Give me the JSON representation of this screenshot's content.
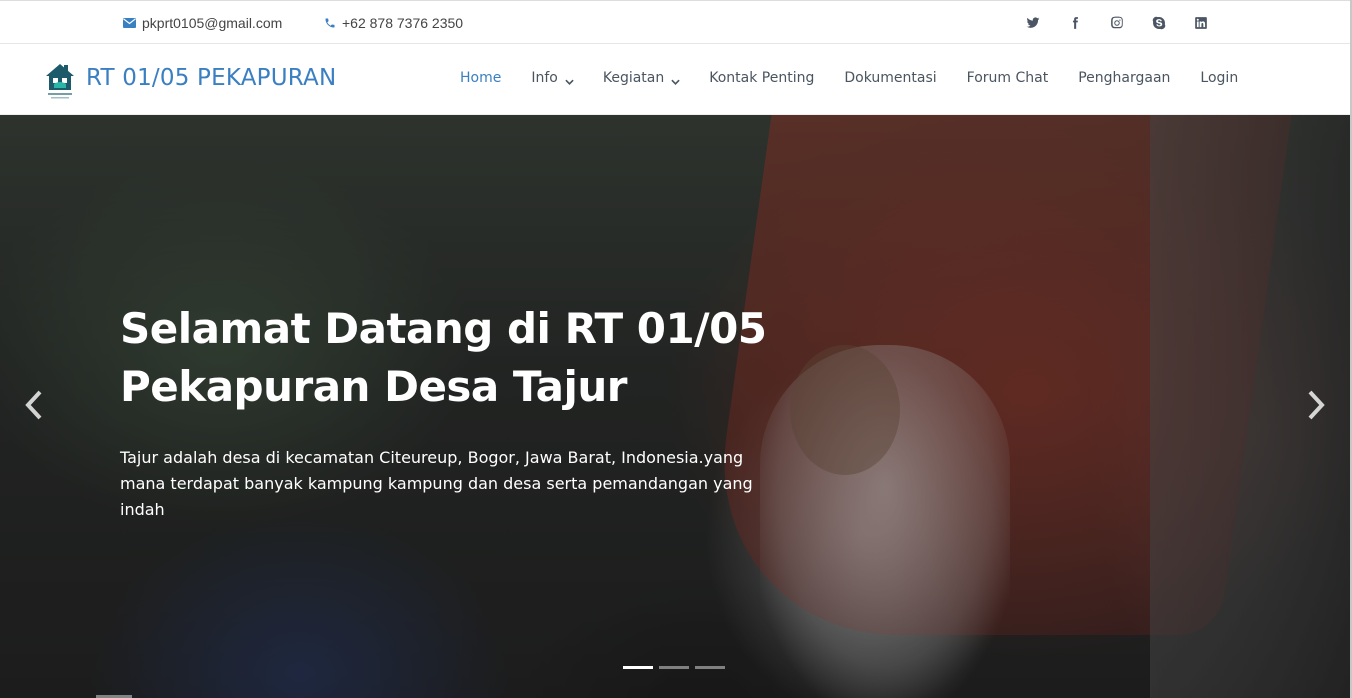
{
  "topbar": {
    "email": "pkprt0105@gmail.com",
    "phone": "+62 878 7376 2350",
    "socials": [
      {
        "icon": "twitter-icon"
      },
      {
        "icon": "facebook-icon"
      },
      {
        "icon": "instagram-icon"
      },
      {
        "icon": "skype-icon"
      },
      {
        "icon": "linkedin-icon"
      }
    ]
  },
  "header": {
    "brand": "RT 01/05 PEKAPURAN",
    "nav": [
      {
        "label": "Home",
        "active": true,
        "dropdown": false
      },
      {
        "label": "Info",
        "active": false,
        "dropdown": true
      },
      {
        "label": "Kegiatan",
        "active": false,
        "dropdown": true
      },
      {
        "label": "Kontak Penting",
        "active": false,
        "dropdown": false
      },
      {
        "label": "Dokumentasi",
        "active": false,
        "dropdown": false
      },
      {
        "label": "Forum Chat",
        "active": false,
        "dropdown": false
      },
      {
        "label": "Penghargaan",
        "active": false,
        "dropdown": false
      },
      {
        "label": "Login",
        "active": false,
        "dropdown": false
      }
    ]
  },
  "hero": {
    "title": "Selamat Datang di RT 01/05 Pekapuran Desa Tajur",
    "description": "Tajur adalah desa di kecamatan Citeureup, Bogor, Jawa Barat, Indonesia.yang mana terdapat banyak kampung kampung dan desa serta pemandangan yang indah",
    "slides_total": 3,
    "active_slide": 1
  },
  "colors": {
    "accent": "#3a7fc2",
    "nav_text": "#4a5560",
    "hero_text": "#ffffff"
  }
}
